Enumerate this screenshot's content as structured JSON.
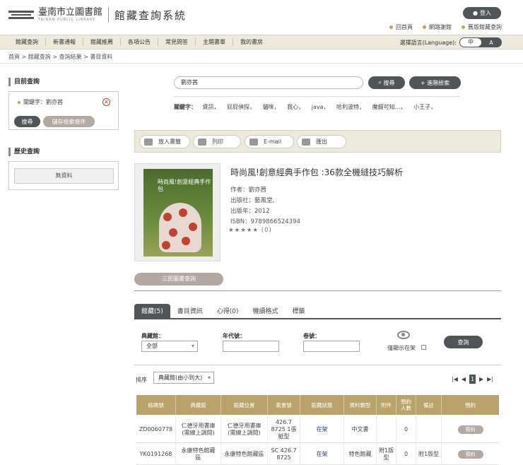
{
  "header": {
    "logo_zh": "臺南市立圖書館",
    "logo_en": "TAINAN PUBLIC LIBRARY",
    "system_title": "館藏查詢系統",
    "login_label": "登入",
    "links": [
      "回首頁",
      "網路謝館",
      "舊版館藏查詢"
    ]
  },
  "nav": {
    "items": [
      "館藏查詢",
      "新書通報",
      "館藏推薦",
      "各項公告",
      "常見問答",
      "主題書單",
      "我的書房"
    ],
    "lang_label": "選擇語言(Language):",
    "lang_on": "中",
    "lang_off": "A"
  },
  "breadcrumb": "首頁 > 館藏查詢 > 查詢結果 > 書目資料",
  "sidebar": {
    "current_title": "目前查詢",
    "keyword_label": "關鍵字：劉亦茜",
    "search_btn": "搜尋",
    "save_btn": "儲存檢索條件",
    "history_title": "歷史查詢",
    "no_data": "無資料"
  },
  "search": {
    "value": "劉亦茜",
    "search_btn": "搜尋",
    "advanced_btn": "進階檢索",
    "keywords_label": "關鍵字：",
    "keywords": [
      "資訊，",
      "屁屁偵探，",
      "貓咪，",
      "我心，",
      "java，",
      "哈利波特，",
      "魔鏡可知…，",
      "小王子，"
    ]
  },
  "toolbar": {
    "buttons": [
      "放入書籤",
      "列印",
      "E-mail",
      "匯出"
    ]
  },
  "book": {
    "cover_text": "時尚風!創意經典手作包",
    "title": "時尚風!創意經典手作包 :36款全機縫技巧解析",
    "author": "作者：劉亦茜",
    "publisher": "出版社：藝風堂,",
    "year": "出版年：2012",
    "isbn": "ISBN：9789866524394",
    "stars": "★★★★★ (0)",
    "sanmin_btn": "三民圖書查詢"
  },
  "tabs": [
    "館藏(5)",
    "書目資訊",
    "心得(0)",
    "機讀格式",
    "標籤"
  ],
  "filters": {
    "library_label": "典藏館：",
    "library_value": "全部",
    "year_label": "年代號：",
    "volume_label": "卷號：",
    "only_available": "僅顯示在架",
    "query_btn": "查詢",
    "sort_label": "排序",
    "sort_value": "典藏館(由小到大)",
    "page": "1"
  },
  "table": {
    "headers": [
      "條碼號",
      "典藏館",
      "館藏位置",
      "索書號",
      "館藏狀態",
      "資料類型",
      "附件",
      "預約人數",
      "備註",
      "預約"
    ],
    "rows": [
      [
        "ZD0060778",
        "仁德牙用書庫(需線上調閱)",
        "仁德牙用書庫(需線上調閱)",
        "426.7 8725 1張紙型",
        "在架",
        "中文書",
        "",
        "0",
        "",
        "預約"
      ],
      [
        "YK0191268",
        "永康特色館藏區",
        "永康特色館藏區",
        "SC 426.7 8725",
        "在架",
        "特色館藏",
        "附1版型",
        "0",
        "附1版型",
        "預約"
      ]
    ]
  },
  "colors": {
    "accent": "#b9a36a",
    "dark": "#505658",
    "nav_bg": "#ede9dc"
  }
}
